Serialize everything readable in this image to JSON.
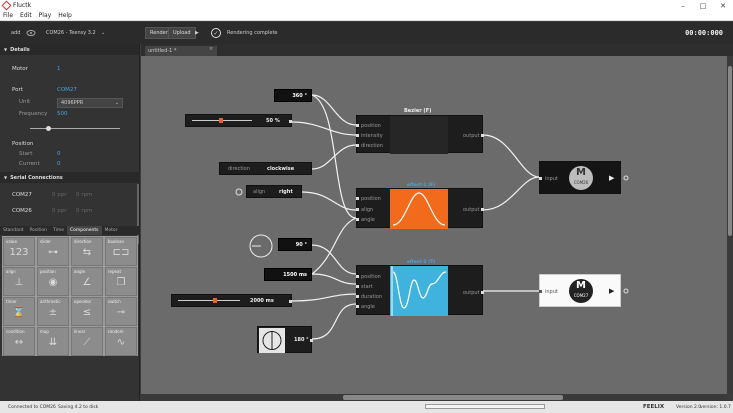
{
  "window": {
    "title": "Fluctk",
    "min": "–",
    "max": "□",
    "close": "✕"
  },
  "menu": [
    "File",
    "Edit",
    "Play",
    "Help"
  ],
  "toolbar": {
    "add": "add",
    "device": "COM26 - Teensy 3.2",
    "render": "Render",
    "upload": "Upload",
    "play_icon": "play-icon",
    "status": "Rendering complete",
    "time": "00:00:000"
  },
  "left": {
    "details_title": "Details",
    "motor_label": "Motor",
    "motor_value": "1",
    "port_label": "Port",
    "port_value": "COM27",
    "unit_label": "Unit",
    "unit_value": "4096PPR",
    "frequency_label": "Frequency",
    "frequency_value": "500",
    "position_label": "Position",
    "start_label": "Start",
    "start_value": "0",
    "current_label": "Current",
    "current_value": "0",
    "serial_title": "Serial Connections",
    "serial": [
      {
        "port": "COM27",
        "ppr": "0 ppr",
        "rpm": "0 rpm"
      },
      {
        "port": "COM26",
        "ppr": "0 ppr",
        "rpm": "0 rpm"
      }
    ],
    "tabs": [
      "Standard",
      "Position",
      "Time",
      "Components",
      "Motor"
    ],
    "components": [
      {
        "label": "value",
        "glyph": "123"
      },
      {
        "label": "slider",
        "glyph": "⊶"
      },
      {
        "label": "direction",
        "glyph": "⇆"
      },
      {
        "label": "boolean",
        "glyph": "⊏⊐"
      },
      {
        "label": "align",
        "glyph": "⊥"
      },
      {
        "label": "position",
        "glyph": "◉"
      },
      {
        "label": "angle",
        "glyph": "∠"
      },
      {
        "label": "repeat",
        "glyph": "❐"
      },
      {
        "label": "timer",
        "glyph": "⌛"
      },
      {
        "label": "arithmetic",
        "glyph": "±"
      },
      {
        "label": "operator",
        "glyph": "≤"
      },
      {
        "label": "switch",
        "glyph": "⊸"
      },
      {
        "label": "condition",
        "glyph": "↔"
      },
      {
        "label": "map",
        "glyph": "⇊"
      },
      {
        "label": "linear",
        "glyph": "⟋"
      },
      {
        "label": "random",
        "glyph": "∿"
      }
    ]
  },
  "doc_tab": {
    "label": "untitled-1 *",
    "close": "×"
  },
  "nodes": {
    "angle_top": "360 °",
    "intensity": "50 %",
    "direction_label": "direction",
    "direction_value": "clockwise",
    "align_label": "align",
    "align_value": "right",
    "bezier": {
      "title": "Bezier (F)",
      "inputs": [
        "position",
        "intensity",
        "direction"
      ],
      "output": "output"
    },
    "effect1": {
      "title": "effect-1 (F)",
      "inputs": [
        "position",
        "align",
        "angle"
      ],
      "output": "output"
    },
    "effect2": {
      "title": "effect-2 (T)",
      "inputs": [
        "position",
        "start",
        "duration",
        "angle"
      ],
      "output": "output"
    },
    "angle_mid": "90 °",
    "duration": "1500 ms",
    "slider_time": "2000 ms",
    "angle_low": "180 °",
    "motor1": {
      "input": "input",
      "letter": "M",
      "port": "COM26"
    },
    "motor2": {
      "input": "input",
      "letter": "M",
      "port": "COM27"
    }
  },
  "status": {
    "left": "Connected to COM26",
    "middle": "Saving 4.2 to disk",
    "brand": "FEELIX",
    "version": "Version 2.0",
    "build": "version: 1.0.7"
  }
}
